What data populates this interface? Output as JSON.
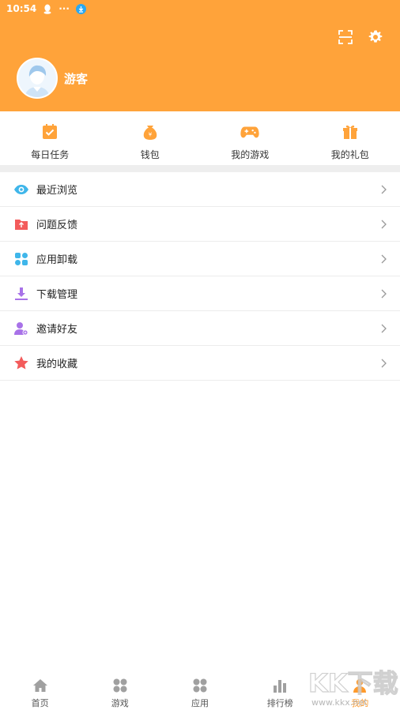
{
  "status_bar": {
    "time": "10:54",
    "dots": "···"
  },
  "colors": {
    "accent": "#ffa33a",
    "active_nav": "#ff9a2b"
  },
  "header": {
    "username": "游客",
    "scan_icon": "scan-icon",
    "settings_icon": "gear-icon"
  },
  "quick_items": [
    {
      "label": "每日任务",
      "icon": "task-icon"
    },
    {
      "label": "钱包",
      "icon": "money-bag-icon"
    },
    {
      "label": "我的游戏",
      "icon": "gamepad-icon"
    },
    {
      "label": "我的礼包",
      "icon": "gift-icon"
    }
  ],
  "menu": [
    {
      "label": "最近浏览",
      "icon": "eye-icon"
    },
    {
      "label": "问题反馈",
      "icon": "folder-icon"
    },
    {
      "label": "应用卸载",
      "icon": "apps-icon"
    },
    {
      "label": "下载管理",
      "icon": "download-icon"
    },
    {
      "label": "邀请好友",
      "icon": "invite-user-icon"
    },
    {
      "label": "我的收藏",
      "icon": "star-icon"
    }
  ],
  "bottom_nav": [
    {
      "label": "首页",
      "icon": "home-icon"
    },
    {
      "label": "游戏",
      "icon": "grid-icon"
    },
    {
      "label": "应用",
      "icon": "grid-icon"
    },
    {
      "label": "排行榜",
      "icon": "bar-chart-icon"
    },
    {
      "label": "我的",
      "icon": "person-icon",
      "active": true
    }
  ],
  "watermark": {
    "text": "KK下载",
    "url": "www.kkx.net"
  }
}
